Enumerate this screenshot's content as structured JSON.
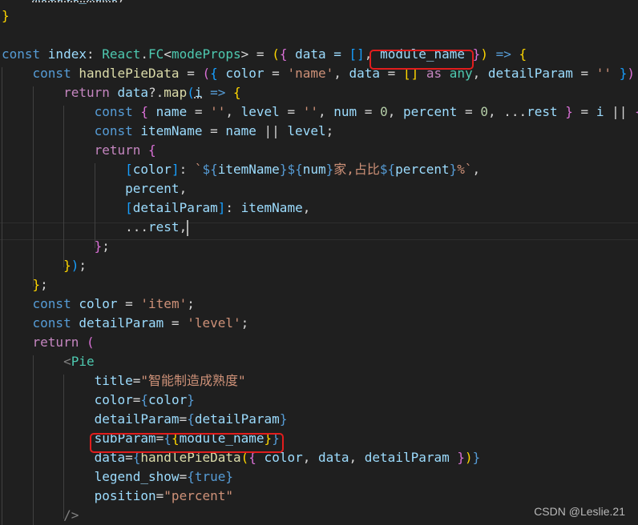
{
  "editor": {
    "lines": [
      [
        {
          "t": "    "
        },
        {
          "t": "module_name",
          "c": "v u"
        },
        {
          "t": ";",
          "c": "w"
        }
      ],
      [
        {
          "t": "}",
          "c": "b1"
        }
      ],
      [
        {
          "t": ""
        }
      ],
      [
        {
          "t": "const ",
          "c": "k"
        },
        {
          "t": "index",
          "c": "v"
        },
        {
          "t": ": ",
          "c": "w"
        },
        {
          "t": "React",
          "c": "t"
        },
        {
          "t": ".",
          "c": "w"
        },
        {
          "t": "FC",
          "c": "t"
        },
        {
          "t": "<",
          "c": "w"
        },
        {
          "t": "modeProps",
          "c": "t"
        },
        {
          "t": "> = ",
          "c": "w"
        },
        {
          "t": "(",
          "c": "b1"
        },
        {
          "t": "{",
          "c": "b2"
        },
        {
          "t": " data = ",
          "c": "v"
        },
        {
          "t": "[]",
          "c": "b3"
        },
        {
          "t": ",",
          "c": "w"
        },
        {
          "t": " module_name ",
          "c": "v"
        },
        {
          "t": "}",
          "c": "b2"
        },
        {
          "t": ")",
          "c": "b1"
        },
        {
          "t": " => ",
          "c": "k"
        },
        {
          "t": "{",
          "c": "b1"
        }
      ],
      [
        {
          "t": "    "
        },
        {
          "t": "const ",
          "c": "k"
        },
        {
          "t": "handlePieData",
          "c": "f"
        },
        {
          "t": " = ",
          "c": "w"
        },
        {
          "t": "(",
          "c": "b2"
        },
        {
          "t": "{",
          "c": "b3"
        },
        {
          "t": " color",
          "c": "v"
        },
        {
          "t": " = ",
          "c": "w"
        },
        {
          "t": "'name'",
          "c": "s"
        },
        {
          "t": ", ",
          "c": "w"
        },
        {
          "t": "data",
          "c": "v"
        },
        {
          "t": " = ",
          "c": "w"
        },
        {
          "t": "[]",
          "c": "b1"
        },
        {
          "t": " as ",
          "c": "kc"
        },
        {
          "t": "any",
          "c": "t"
        },
        {
          "t": ", ",
          "c": "w"
        },
        {
          "t": "detailParam",
          "c": "v"
        },
        {
          "t": " = ",
          "c": "w"
        },
        {
          "t": "''",
          "c": "s"
        },
        {
          "t": " }",
          "c": "b3"
        },
        {
          "t": ")",
          "c": "b2"
        }
      ],
      [
        {
          "t": "        "
        },
        {
          "t": "return ",
          "c": "kc"
        },
        {
          "t": "data",
          "c": "v"
        },
        {
          "t": "?.",
          "c": "w"
        },
        {
          "t": "map",
          "c": "f"
        },
        {
          "t": "(",
          "c": "b3"
        },
        {
          "t": "i",
          "c": "v u"
        },
        {
          "t": " => ",
          "c": "k"
        },
        {
          "t": "{",
          "c": "b1"
        }
      ],
      [
        {
          "t": "            "
        },
        {
          "t": "const ",
          "c": "k"
        },
        {
          "t": "{",
          "c": "b2"
        },
        {
          "t": " name",
          "c": "v"
        },
        {
          "t": " = ",
          "c": "w"
        },
        {
          "t": "''",
          "c": "s"
        },
        {
          "t": ", ",
          "c": "w"
        },
        {
          "t": "level",
          "c": "v"
        },
        {
          "t": " = ",
          "c": "w"
        },
        {
          "t": "''",
          "c": "s"
        },
        {
          "t": ", ",
          "c": "w"
        },
        {
          "t": "num",
          "c": "v"
        },
        {
          "t": " = ",
          "c": "w"
        },
        {
          "t": "0",
          "c": "n"
        },
        {
          "t": ", ",
          "c": "w"
        },
        {
          "t": "percent",
          "c": "v"
        },
        {
          "t": " = ",
          "c": "w"
        },
        {
          "t": "0",
          "c": "n"
        },
        {
          "t": ", ...",
          "c": "w"
        },
        {
          "t": "rest",
          "c": "v"
        },
        {
          "t": " }",
          "c": "b2"
        },
        {
          "t": " = ",
          "c": "w"
        },
        {
          "t": "i",
          "c": "v"
        },
        {
          "t": " || ",
          "c": "w"
        },
        {
          "t": "{",
          "c": "b2"
        }
      ],
      [
        {
          "t": "            "
        },
        {
          "t": "const ",
          "c": "k"
        },
        {
          "t": "itemName",
          "c": "v"
        },
        {
          "t": " = ",
          "c": "w"
        },
        {
          "t": "name",
          "c": "v"
        },
        {
          "t": " || ",
          "c": "w"
        },
        {
          "t": "level",
          "c": "v"
        },
        {
          "t": ";",
          "c": "w"
        }
      ],
      [
        {
          "t": "            "
        },
        {
          "t": "return ",
          "c": "kc"
        },
        {
          "t": "{",
          "c": "b2"
        }
      ],
      [
        {
          "t": "                "
        },
        {
          "t": "[",
          "c": "b3"
        },
        {
          "t": "color",
          "c": "v"
        },
        {
          "t": "]",
          "c": "b3"
        },
        {
          "t": ": ",
          "c": "w"
        },
        {
          "t": "`",
          "c": "s"
        },
        {
          "t": "${",
          "c": "k"
        },
        {
          "t": "itemName",
          "c": "v"
        },
        {
          "t": "}",
          "c": "k"
        },
        {
          "t": "${",
          "c": "k"
        },
        {
          "t": "num",
          "c": "v"
        },
        {
          "t": "}",
          "c": "k"
        },
        {
          "t": "家,占比",
          "c": "s"
        },
        {
          "t": "${",
          "c": "k"
        },
        {
          "t": "percent",
          "c": "v"
        },
        {
          "t": "}",
          "c": "k"
        },
        {
          "t": "%`",
          "c": "s"
        },
        {
          "t": ",",
          "c": "w"
        }
      ],
      [
        {
          "t": "                "
        },
        {
          "t": "percent",
          "c": "v"
        },
        {
          "t": ",",
          "c": "w"
        }
      ],
      [
        {
          "t": "                "
        },
        {
          "t": "[",
          "c": "b3"
        },
        {
          "t": "detailParam",
          "c": "v"
        },
        {
          "t": "]",
          "c": "b3"
        },
        {
          "t": ": ",
          "c": "w"
        },
        {
          "t": "itemName",
          "c": "v"
        },
        {
          "t": ",",
          "c": "w"
        }
      ],
      [
        {
          "t": "                "
        },
        {
          "t": "...",
          "c": "w"
        },
        {
          "t": "rest",
          "c": "v"
        },
        {
          "t": ",",
          "c": "w"
        },
        {
          "t": "",
          "c": "caret"
        }
      ],
      [
        {
          "t": "            "
        },
        {
          "t": "}",
          "c": "b2"
        },
        {
          "t": ";",
          "c": "w"
        }
      ],
      [
        {
          "t": "        "
        },
        {
          "t": "}",
          "c": "b1"
        },
        {
          "t": ")",
          "c": "b3"
        },
        {
          "t": ";",
          "c": "w"
        }
      ],
      [
        {
          "t": "    "
        },
        {
          "t": "}",
          "c": "b1"
        },
        {
          "t": ";",
          "c": "w"
        }
      ],
      [
        {
          "t": "    "
        },
        {
          "t": "const ",
          "c": "k"
        },
        {
          "t": "color",
          "c": "v"
        },
        {
          "t": " = ",
          "c": "w"
        },
        {
          "t": "'item'",
          "c": "s"
        },
        {
          "t": ";",
          "c": "w"
        }
      ],
      [
        {
          "t": "    "
        },
        {
          "t": "const ",
          "c": "k"
        },
        {
          "t": "detailParam",
          "c": "v"
        },
        {
          "t": " = ",
          "c": "w"
        },
        {
          "t": "'level'",
          "c": "s"
        },
        {
          "t": ";",
          "c": "w"
        }
      ],
      [
        {
          "t": "    "
        },
        {
          "t": "return ",
          "c": "kc"
        },
        {
          "t": "(",
          "c": "b2"
        }
      ],
      [
        {
          "t": "        "
        },
        {
          "t": "<",
          "c": "tb"
        },
        {
          "t": "Pie",
          "c": "tag"
        }
      ],
      [
        {
          "t": "            "
        },
        {
          "t": "title",
          "c": "v"
        },
        {
          "t": "=",
          "c": "w"
        },
        {
          "t": "\"智能制造成熟度\"",
          "c": "s"
        }
      ],
      [
        {
          "t": "            "
        },
        {
          "t": "color",
          "c": "v"
        },
        {
          "t": "=",
          "c": "w"
        },
        {
          "t": "{",
          "c": "k"
        },
        {
          "t": "color",
          "c": "v"
        },
        {
          "t": "}",
          "c": "k"
        }
      ],
      [
        {
          "t": "            "
        },
        {
          "t": "detailParam",
          "c": "v"
        },
        {
          "t": "=",
          "c": "w"
        },
        {
          "t": "{",
          "c": "k"
        },
        {
          "t": "detailParam",
          "c": "v"
        },
        {
          "t": "}",
          "c": "k"
        }
      ],
      [
        {
          "t": "            "
        },
        {
          "t": "subParam",
          "c": "v"
        },
        {
          "t": "=",
          "c": "w"
        },
        {
          "t": "{",
          "c": "k"
        },
        {
          "t": "{",
          "c": "b1"
        },
        {
          "t": "module_name",
          "c": "v"
        },
        {
          "t": "}",
          "c": "b1"
        },
        {
          "t": "}",
          "c": "k"
        }
      ],
      [
        {
          "t": "            "
        },
        {
          "t": "data",
          "c": "v"
        },
        {
          "t": "=",
          "c": "w"
        },
        {
          "t": "{",
          "c": "k"
        },
        {
          "t": "handlePieData",
          "c": "f"
        },
        {
          "t": "(",
          "c": "b1"
        },
        {
          "t": "{",
          "c": "b2"
        },
        {
          "t": " color",
          "c": "v"
        },
        {
          "t": ", ",
          "c": "w"
        },
        {
          "t": "data",
          "c": "v"
        },
        {
          "t": ", ",
          "c": "w"
        },
        {
          "t": "detailParam",
          "c": "v"
        },
        {
          "t": " }",
          "c": "b2"
        },
        {
          "t": ")",
          "c": "b1"
        },
        {
          "t": "}",
          "c": "k"
        }
      ],
      [
        {
          "t": "            "
        },
        {
          "t": "legend_show",
          "c": "v"
        },
        {
          "t": "=",
          "c": "w"
        },
        {
          "t": "{",
          "c": "k"
        },
        {
          "t": "true",
          "c": "k"
        },
        {
          "t": "}",
          "c": "k"
        }
      ],
      [
        {
          "t": "            "
        },
        {
          "t": "position",
          "c": "v"
        },
        {
          "t": "=",
          "c": "w"
        },
        {
          "t": "\"percent\"",
          "c": "s"
        }
      ],
      [
        {
          "t": "        "
        },
        {
          "t": "/>",
          "c": "tb"
        }
      ]
    ]
  },
  "watermark": "CSDN @Leslie.21"
}
